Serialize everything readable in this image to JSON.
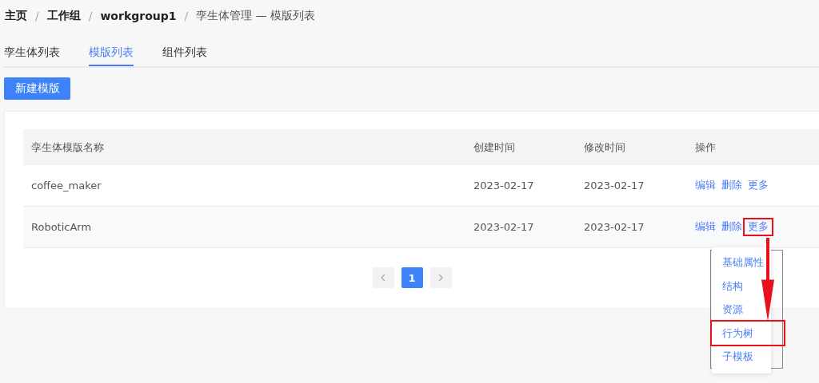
{
  "breadcrumb": [
    {
      "label": "主页",
      "separator": "/",
      "current": false
    },
    {
      "label": "工作组",
      "separator": "/",
      "current": false
    },
    {
      "label": "workgroup1",
      "separator": "/",
      "current": false
    },
    {
      "label": "孪生体管理 — 模版列表",
      "current": true
    }
  ],
  "tabs": [
    {
      "label": "孪生体列表",
      "selected": false
    },
    {
      "label": "模版列表",
      "selected": true
    },
    {
      "label": "组件列表",
      "selected": false
    }
  ],
  "new_button": "新建模版",
  "table": {
    "columns": [
      "孪生体模版名称",
      "创建时间",
      "修改时间",
      "操作"
    ],
    "rows": [
      {
        "name": "coffee_maker",
        "created": "2023-02-17",
        "modified": "2023-02-17",
        "actions": [
          {
            "label": "编辑",
            "highlighted": false
          },
          {
            "label": "删除",
            "highlighted": false
          },
          {
            "label": "更多",
            "highlighted": false
          }
        ]
      },
      {
        "name": "RoboticArm",
        "created": "2023-02-17",
        "modified": "2023-02-17",
        "actions": [
          {
            "label": "编辑",
            "highlighted": false
          },
          {
            "label": "删除",
            "highlighted": false
          },
          {
            "label": "更多",
            "highlighted": true
          }
        ]
      }
    ]
  },
  "pagination": {
    "pages": [
      {
        "label": "1",
        "selected": true
      }
    ]
  },
  "dropdown": {
    "items": [
      {
        "label": "基础属性",
        "highlighted": false
      },
      {
        "label": "结构",
        "highlighted": false
      },
      {
        "label": "资源",
        "highlighted": false
      },
      {
        "label": "行为树",
        "highlighted": true
      },
      {
        "label": "子模板",
        "highlighted": false
      }
    ]
  }
}
